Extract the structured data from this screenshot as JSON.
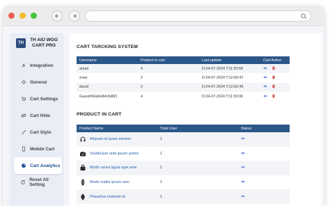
{
  "sidebar": {
    "brand": "TH AIO WOO CART PRO",
    "brand_logo": "TH",
    "items": [
      {
        "label": "Integration",
        "icon": "wrench-icon",
        "active": false
      },
      {
        "label": "General",
        "icon": "gear-icon",
        "active": false
      },
      {
        "label": "Cart Settings",
        "icon": "cart-icon",
        "active": false
      },
      {
        "label": "Cart Hide",
        "icon": "eye-off-icon",
        "active": false
      },
      {
        "label": "Cart Style",
        "icon": "brush-icon",
        "active": false
      },
      {
        "label": "Mobile Cart",
        "icon": "mobile-icon",
        "active": false
      },
      {
        "label": "Cart Analytics",
        "icon": "analytics-icon",
        "active": true
      },
      {
        "label": "Reset All Setting",
        "icon": "reset-icon",
        "active": false
      }
    ]
  },
  "tracking": {
    "title": "CART TARCKING SYSTEM",
    "headers": [
      "Username",
      "Product in cart",
      "Last update",
      "Cart Action"
    ],
    "rows": [
      {
        "username": "aman",
        "products": "4",
        "updated": "D:24-07-2024 T:11:50:58"
      },
      {
        "username": "zoey",
        "products": "2",
        "updated": "D:24-07-2024 T:12:00:47"
      },
      {
        "username": "david",
        "products": "2",
        "updated": "D:24-07-2024 T:12:02:45"
      },
      {
        "username": "Guest#66a0e84c6d6f1",
        "products": "4",
        "updated": "D:24-07-2024 T:11:53:06"
      }
    ]
  },
  "products": {
    "title": "PRODUCT IN CART",
    "headers": [
      "Product Name",
      "Total User",
      "Status"
    ],
    "rows": [
      {
        "name": "Aliquam id quam elemen",
        "users": "1",
        "icon": "headphones-icon"
      },
      {
        "name": "Vestibulum ante ipsum primis",
        "users": "1",
        "icon": "camera-icon"
      },
      {
        "name": "Morbi varius ligula eget ante",
        "users": "1",
        "icon": "bag-icon"
      },
      {
        "name": "Morbi mattis ipsum sem",
        "users": "1",
        "icon": "watch-icon"
      },
      {
        "name": "Phasellus molestie id",
        "users": "1",
        "icon": "smartwatch-icon"
      }
    ]
  },
  "colors": {
    "accent": "#2b5688",
    "link": "#2a5fb0",
    "view": "#3b6ad1",
    "delete": "#d9534f"
  }
}
